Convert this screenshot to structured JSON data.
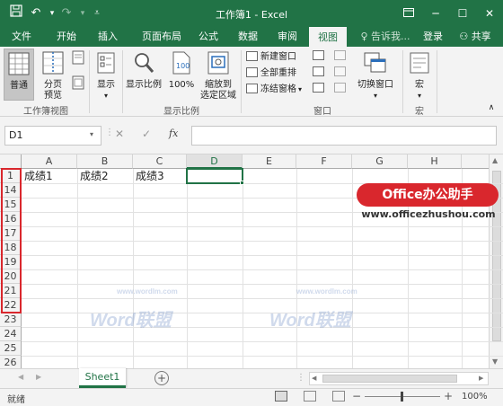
{
  "window": {
    "title": "工作簿1 - Excel",
    "accent": "#217346"
  },
  "quick_access": {
    "save_icon": "save-icon",
    "undo_icon": "undo-icon",
    "redo_icon": "redo-icon",
    "customize_icon": "customize-icon"
  },
  "tabs": [
    {
      "label": "文件"
    },
    {
      "label": "开始"
    },
    {
      "label": "插入"
    },
    {
      "label": "页面布局"
    },
    {
      "label": "公式"
    },
    {
      "label": "数据"
    },
    {
      "label": "审阅"
    },
    {
      "label": "视图",
      "active": true
    }
  ],
  "tell_me": "告诉我...",
  "login": "登录",
  "share": "共享",
  "ribbon": {
    "workbook_views": {
      "group_label": "工作簿视图",
      "normal": "普通",
      "page_break_1": "分页",
      "page_break_2": "预览"
    },
    "show": {
      "label": "显示"
    },
    "zoom": {
      "group_label": "显示比例",
      "zoom_label": "显示比例",
      "zoom_100": "100%",
      "zoom_selection_1": "缩放到",
      "zoom_selection_2": "选定区域"
    },
    "window": {
      "group_label": "窗口",
      "new_window": "新建窗口",
      "arrange_all": "全部重排",
      "freeze_panes": "冻结窗格",
      "switch_windows": "切换窗口"
    },
    "macros": {
      "group_label": "宏",
      "label": "宏"
    }
  },
  "formula_bar": {
    "name_box": "D1",
    "fx": "fx",
    "cancel": "✕",
    "enter": "✓",
    "value": ""
  },
  "grid": {
    "columns": [
      "A",
      "B",
      "C",
      "D",
      "E",
      "F",
      "G",
      "H"
    ],
    "selected_column": "D",
    "rows": [
      "1",
      "14",
      "15",
      "16",
      "17",
      "18",
      "19",
      "20",
      "21",
      "22",
      "23",
      "24",
      "25",
      "26"
    ],
    "cells": {
      "A1": "成绩1",
      "B1": "成绩2",
      "C1": "成绩3"
    }
  },
  "sheets": [
    {
      "label": "Sheet1",
      "active": true
    }
  ],
  "status": {
    "ready": "就绪",
    "zoom": "100%"
  },
  "overlay": {
    "watermark": "Word联盟",
    "watermark_url": "www.wordlm.com",
    "banner": "Office办公助手",
    "banner_url": "www.officezhushou.com",
    "banner_color": "#d9272d"
  }
}
